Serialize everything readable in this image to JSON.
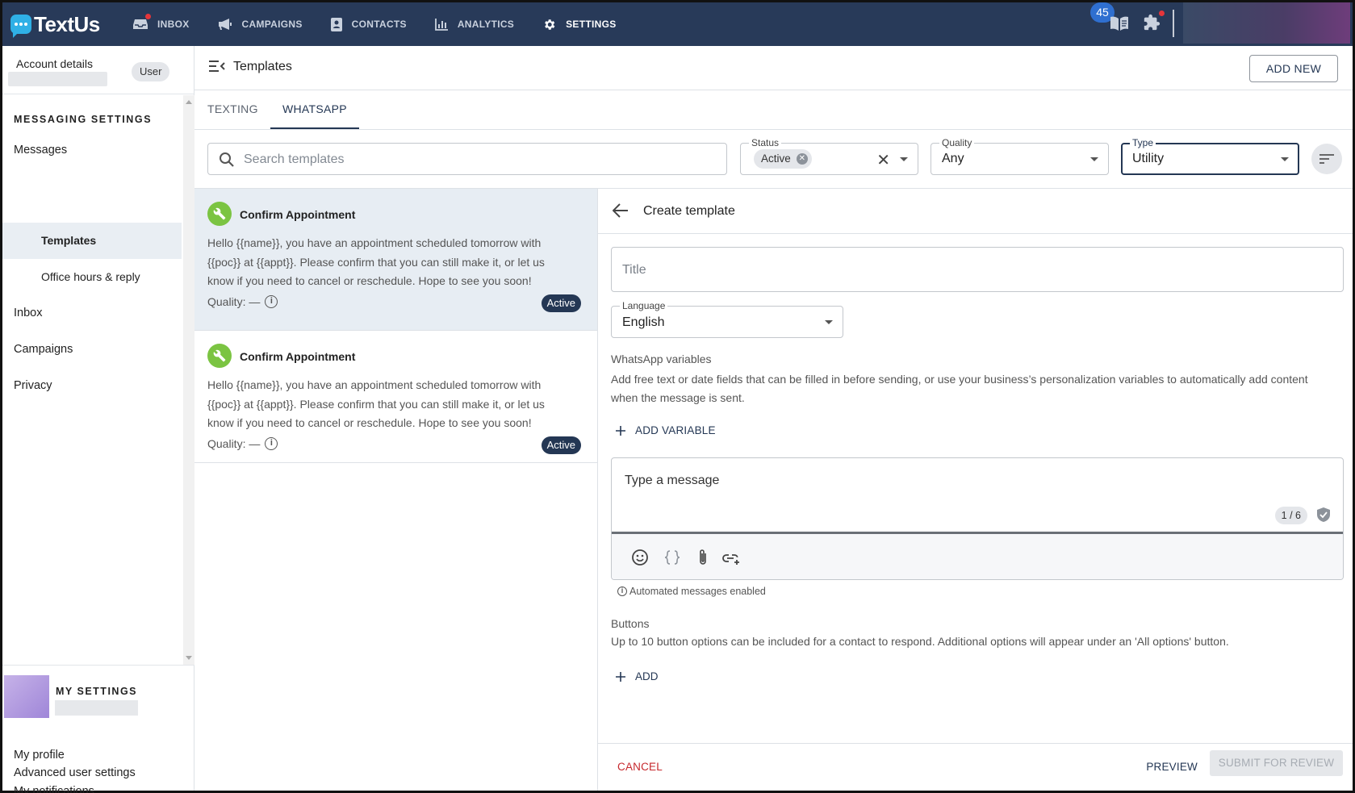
{
  "app": {
    "logo_text": "TextUs",
    "notification_count": "45"
  },
  "nav": {
    "items": [
      {
        "label": "INBOX",
        "icon": "inbox-icon"
      },
      {
        "label": "CAMPAIGNS",
        "icon": "megaphone-icon"
      },
      {
        "label": "CONTACTS",
        "icon": "contacts-icon"
      },
      {
        "label": "ANALYTICS",
        "icon": "bar-chart-icon"
      },
      {
        "label": "SETTINGS",
        "icon": "gear-icon"
      }
    ],
    "active": "SETTINGS"
  },
  "sidebar": {
    "account_label": "Account details",
    "user_chip": "User",
    "section_title": "MESSAGING SETTINGS",
    "items": [
      {
        "label": "Messages"
      },
      {
        "label": "Templates",
        "active": true
      },
      {
        "label": "Office hours & reply"
      },
      {
        "label": "Inbox"
      },
      {
        "label": "Campaigns"
      },
      {
        "label": "Privacy"
      }
    ],
    "my_settings": {
      "title": "MY SETTINGS",
      "items": [
        {
          "label": "My profile"
        },
        {
          "label": "My notifications"
        },
        {
          "label": "Advanced user settings"
        }
      ]
    }
  },
  "header": {
    "title": "Templates",
    "add_new_label": "ADD NEW"
  },
  "tabs": [
    {
      "label": "TEXTING"
    },
    {
      "label": "WHATSAPP",
      "active": true
    }
  ],
  "filters": {
    "search_placeholder": "Search templates",
    "status": {
      "label": "Status",
      "chip": "Active"
    },
    "quality": {
      "label": "Quality",
      "value": "Any"
    },
    "type": {
      "label": "Type",
      "value": "Utility"
    }
  },
  "templates": [
    {
      "title": "Confirm Appointment",
      "body": "Hello {{name}}, you have an appointment scheduled tomorrow with {{poc}} at {{appt}}. Please confirm that you can still make it, or let us know if you need to cancel or reschedule. Hope to see you soon!",
      "quality": "Quality: —",
      "status": "Active"
    },
    {
      "title": "Confirm Appointment",
      "body": "Hello {{name}}, you have an appointment scheduled tomorrow with {{poc}} at {{appt}}. Please confirm that you can still make it, or let us know if you need to cancel or reschedule. Hope to see you soon!",
      "quality": "Quality: —",
      "status": "Active"
    }
  ],
  "create": {
    "title": "Create template",
    "title_placeholder": "Title",
    "language": {
      "label": "Language",
      "value": "English"
    },
    "variables_title": "WhatsApp variables",
    "variables_desc": "Add free text or date fields that can be filled in before sending, or use your business’s personalization variables to automatically add content when the message is sent.",
    "add_variable_label": "ADD VARIABLE",
    "message_placeholder": "Type a message",
    "counter": "1 / 6",
    "automated_note": "Automated messages enabled",
    "buttons_title": "Buttons",
    "buttons_desc": "Up to 10 button options can be included for a contact to respond. Additional options will appear under an 'All options' button.",
    "add_label": "ADD",
    "cancel_label": "CANCEL",
    "preview_label": "PREVIEW",
    "submit_label": "SUBMIT FOR REVIEW"
  },
  "colors": {
    "nav_bg": "#283a59",
    "accent": "#243754",
    "template_icon": "#7bc442",
    "cancel": "#c6282d"
  }
}
